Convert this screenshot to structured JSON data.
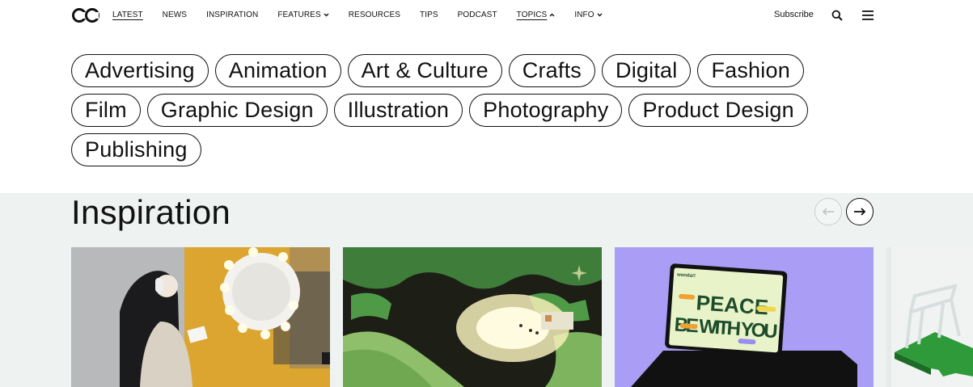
{
  "nav": {
    "logo": "CC",
    "links": [
      {
        "label": "LATEST",
        "has_chevron": false
      },
      {
        "label": "NEWS",
        "has_chevron": false
      },
      {
        "label": "INSPIRATION",
        "has_chevron": false
      },
      {
        "label": "FEATURES",
        "has_chevron": true,
        "chevron": "down"
      },
      {
        "label": "RESOURCES",
        "has_chevron": false
      },
      {
        "label": "TIPS",
        "has_chevron": false
      },
      {
        "label": "PODCAST",
        "has_chevron": false
      },
      {
        "label": "TOPICS",
        "has_chevron": true,
        "chevron": "up"
      },
      {
        "label": "INFO",
        "has_chevron": true,
        "chevron": "down"
      }
    ],
    "subscribe": "Subscribe",
    "icons": [
      "search-icon",
      "menu-icon"
    ]
  },
  "topics": {
    "rows": [
      [
        "Advertising",
        "Animation",
        "Art & Culture",
        "Crafts",
        "Digital",
        "Fashion"
      ],
      [
        "Film",
        "Graphic Design",
        "Illustration",
        "Photography",
        "Product Design"
      ],
      [
        "Publishing"
      ]
    ]
  },
  "inspiration": {
    "title": "Inspiration",
    "prev_icon": "arrow-left-icon",
    "next_icon": "arrow-right-icon",
    "card3_texts": {
      "brand": "wonda!!",
      "line1": "PEACE",
      "line2": "BE WITH YOU"
    }
  },
  "colors": {
    "section_bg": "#eef3f2",
    "text": "#111111",
    "card3_bg": "#a99df5",
    "card2_green": "#4f9a47"
  }
}
